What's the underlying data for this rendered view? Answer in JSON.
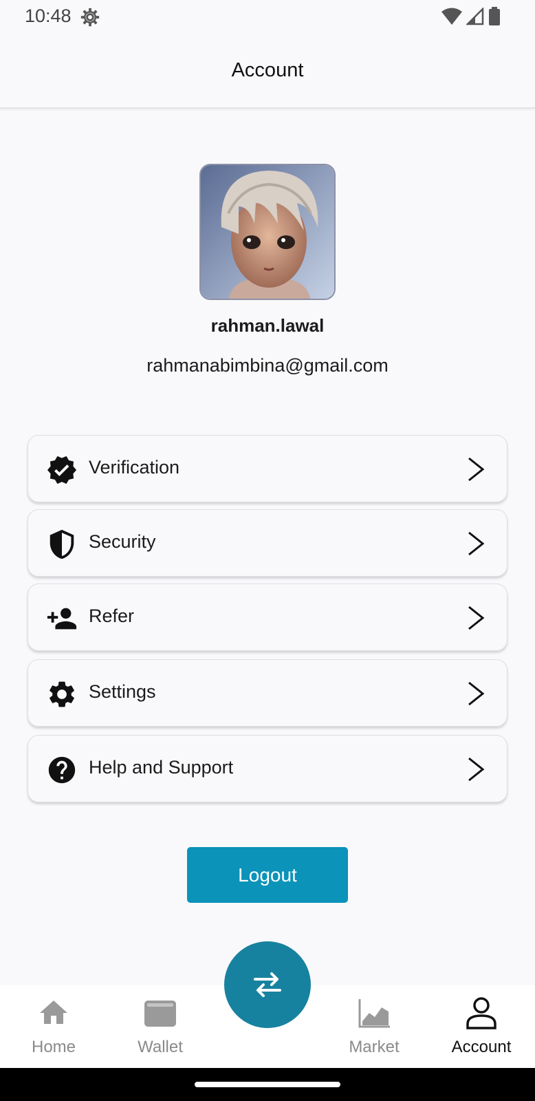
{
  "status_bar": {
    "time": "10:48",
    "icons": [
      "settings-gear-icon",
      "wifi-icon",
      "signal-icon",
      "battery-icon"
    ]
  },
  "header": {
    "title": "Account"
  },
  "profile": {
    "username": "rahman.lawal",
    "email": "rahmanabimbina@gmail.com"
  },
  "menu": {
    "items": [
      {
        "label": "Verification",
        "icon": "verified-badge-icon"
      },
      {
        "label": "Security",
        "icon": "shield-icon"
      },
      {
        "label": "Refer",
        "icon": "add-person-icon"
      },
      {
        "label": "Settings",
        "icon": "gear-icon"
      },
      {
        "label": "Help and Support",
        "icon": "help-icon"
      }
    ]
  },
  "logout": {
    "label": "Logout",
    "color": "#0b93b9"
  },
  "bottom_nav": {
    "items": [
      {
        "label": "Home",
        "icon": "home-icon"
      },
      {
        "label": "Wallet",
        "icon": "wallet-icon"
      },
      {
        "label": "Market",
        "icon": "chart-icon"
      },
      {
        "label": "Account",
        "icon": "account-icon",
        "active": true
      }
    ],
    "fab_icon": "swap-arrows-icon",
    "fab_color": "#17829f"
  }
}
